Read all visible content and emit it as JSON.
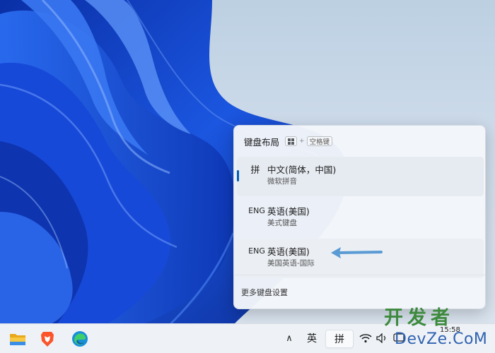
{
  "flyout": {
    "title": "键盘布局",
    "shortcut_key": "空格键",
    "items": [
      {
        "code": "拼",
        "name": "中文(简体，中国)",
        "sub": "微软拼音"
      },
      {
        "code": "ENG",
        "name": "英语(美国)",
        "sub": "美式键盘"
      },
      {
        "code": "ENG",
        "name": "英语(美国)",
        "sub": "美国英语-国际"
      }
    ],
    "more_settings": "更多键盘设置"
  },
  "taskbar": {
    "apps": [
      {
        "icon": "file-explorer-icon"
      },
      {
        "icon": "brave-browser-icon"
      },
      {
        "icon": "edge-browser-icon"
      }
    ],
    "chevron": "∧",
    "ime_mode": "英",
    "ime_lang": "拼",
    "clock_time": "15:58"
  },
  "watermark": {
    "line1": "开发者",
    "line2": "DevZe.CoM"
  },
  "colors": {
    "accent": "#005fb8",
    "arrow": "#5a9bd4",
    "watermark_green": "#3d8a3d",
    "watermark_blue": "#2f62b0"
  }
}
